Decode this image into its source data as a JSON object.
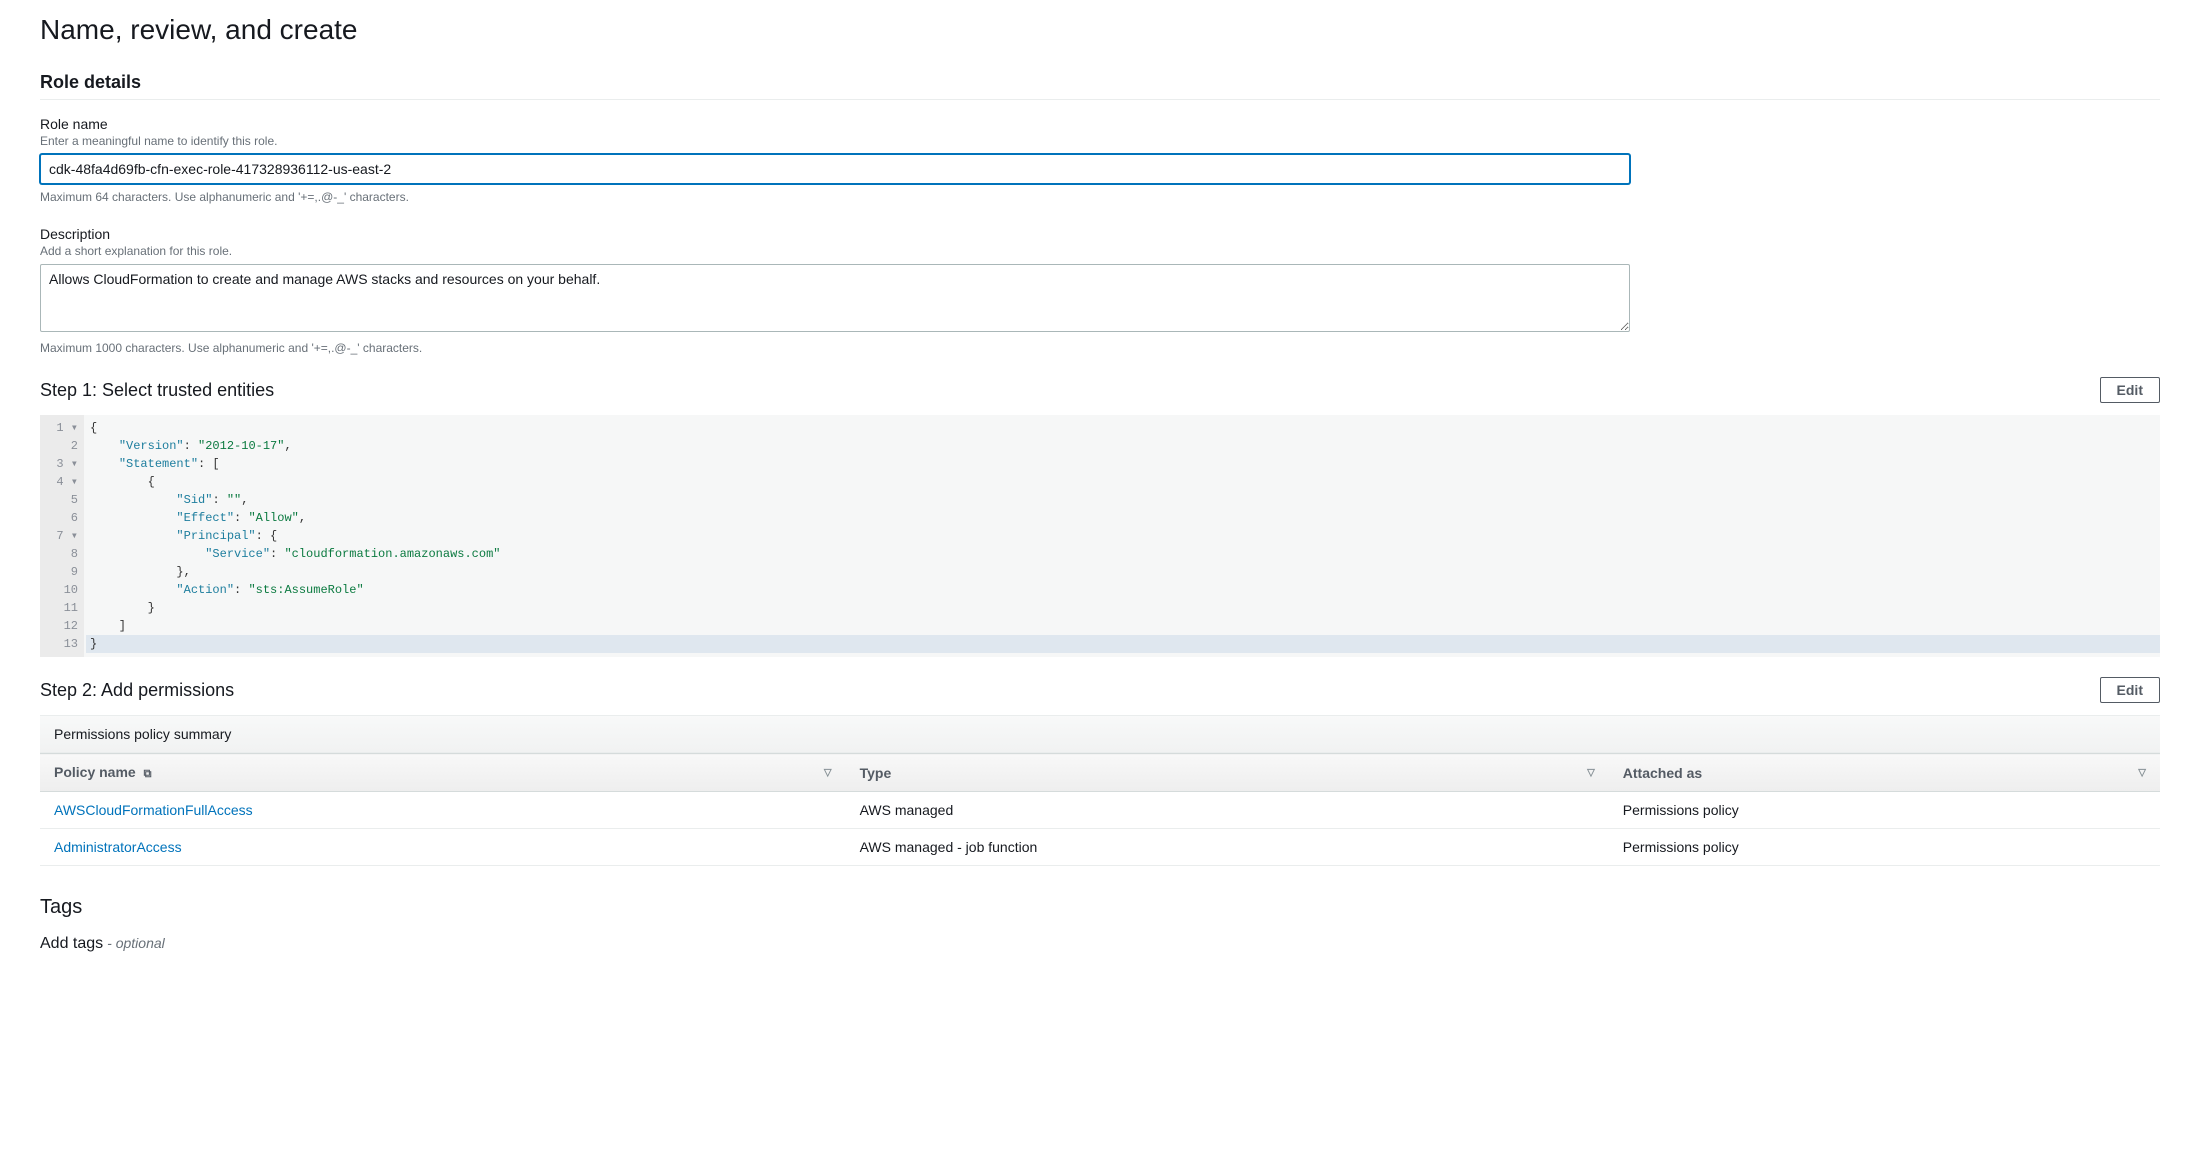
{
  "page_title": "Name, review, and create",
  "role_details": {
    "heading": "Role details",
    "name_label": "Role name",
    "name_hint": "Enter a meaningful name to identify this role.",
    "name_value": "cdk-48fa4d69fb-cfn-exec-role-417328936112-us-east-2",
    "name_subhint": "Maximum 64 characters. Use alphanumeric and '+=,.@-_' characters.",
    "desc_label": "Description",
    "desc_hint": "Add a short explanation for this role.",
    "desc_value": "Allows CloudFormation to create and manage AWS stacks and resources on your behalf.",
    "desc_subhint": "Maximum 1000 characters. Use alphanumeric and '+=,.@-_' characters."
  },
  "step1": {
    "label": "Step 1: Select trusted entities",
    "edit_label": "Edit",
    "gutter": "1 ▾\n2\n3 ▾\n4 ▾\n5\n6\n7 ▾\n8\n9\n10\n11\n12\n13",
    "code": {
      "l1": "{",
      "l2a": "    ",
      "l2k": "\"Version\"",
      "l2b": ": ",
      "l2v": "\"2012-10-17\"",
      "l2c": ",",
      "l3a": "    ",
      "l3k": "\"Statement\"",
      "l3b": ": [",
      "l4": "        {",
      "l5a": "            ",
      "l5k": "\"Sid\"",
      "l5b": ": ",
      "l5v": "\"\"",
      "l5c": ",",
      "l6a": "            ",
      "l6k": "\"Effect\"",
      "l6b": ": ",
      "l6v": "\"Allow\"",
      "l6c": ",",
      "l7a": "            ",
      "l7k": "\"Principal\"",
      "l7b": ": {",
      "l8a": "                ",
      "l8k": "\"Service\"",
      "l8b": ": ",
      "l8v": "\"cloudformation.amazonaws.com\"",
      "l9": "            },",
      "l10a": "            ",
      "l10k": "\"Action\"",
      "l10b": ": ",
      "l10v": "\"sts:AssumeRole\"",
      "l11": "        }",
      "l12": "    ]",
      "l13": "}"
    }
  },
  "step2": {
    "label": "Step 2: Add permissions",
    "edit_label": "Edit",
    "summary_label": "Permissions policy summary",
    "columns": {
      "name": "Policy name",
      "type": "Type",
      "attached": "Attached as"
    },
    "rows": [
      {
        "name": "AWSCloudFormationFullAccess",
        "type": "AWS managed",
        "attached": "Permissions policy"
      },
      {
        "name": "AdministratorAccess",
        "type": "AWS managed - job function",
        "attached": "Permissions policy"
      }
    ]
  },
  "tags": {
    "heading": "Tags",
    "add_label": "Add tags",
    "optional": "- optional"
  }
}
